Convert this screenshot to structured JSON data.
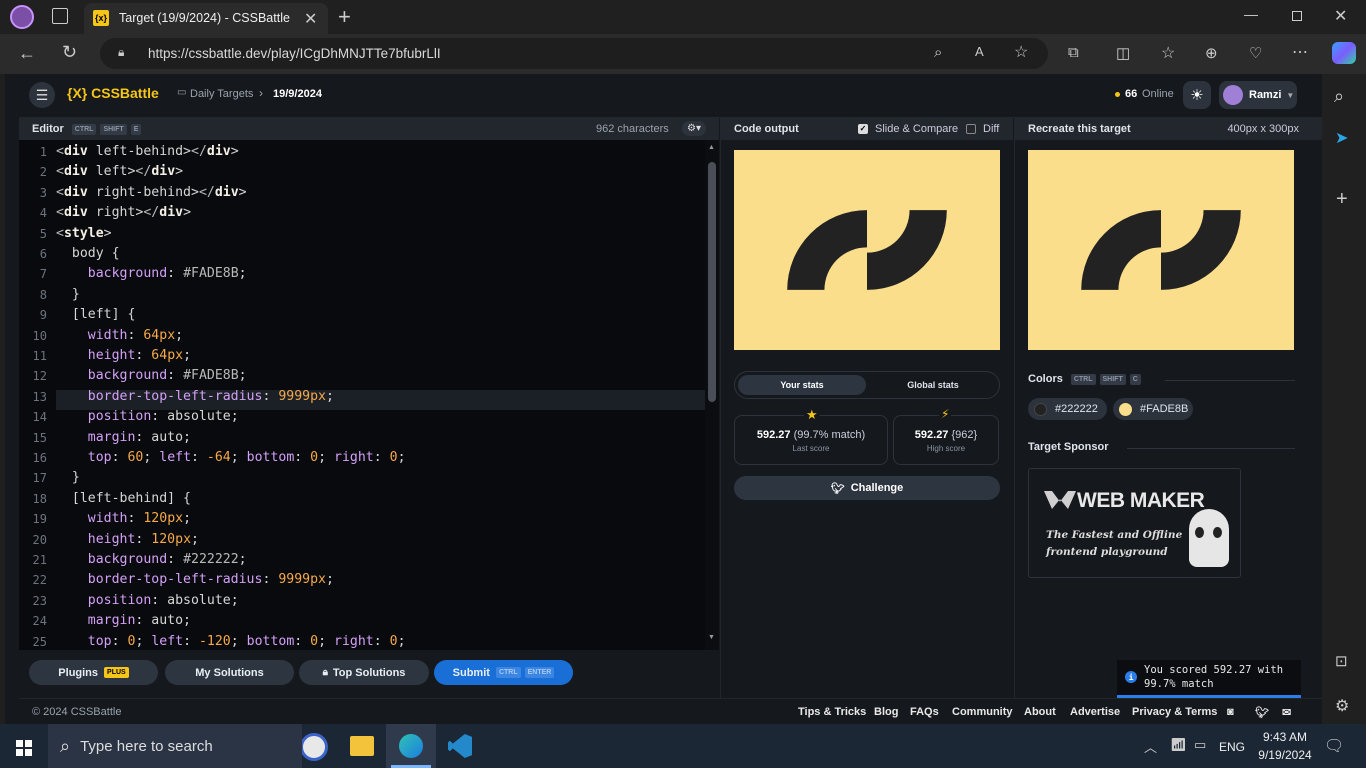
{
  "browser": {
    "tab_title": "Target (19/9/2024) - CSSBattle",
    "url": "https://cssbattle.dev/play/ICgDhMNJTTe7bfubrLlI"
  },
  "header": {
    "logo": "{X} CSSBattle",
    "breadcrumb_parent": "Daily Targets",
    "breadcrumb_current": "19/9/2024",
    "online_count": "66",
    "online_label": "Online",
    "user_name": "Ramzi"
  },
  "editor": {
    "title": "Editor",
    "shortcut": [
      "CTRL",
      "SHIFT",
      "E"
    ],
    "char_count": "962 characters",
    "lines": [
      "<div left-behind></div>",
      "<div left></div>",
      "<div right-behind></div>",
      "<div right></div>",
      "<style>",
      "  body {",
      "    background: #FADE8B;",
      "  }",
      "  [left] {",
      "    width: 64px;",
      "    height: 64px;",
      "    background: #FADE8B;",
      "    border-top-left-radius: 9999px;",
      "    position: absolute;",
      "    margin: auto;",
      "    top: 60; left: -64; bottom: 0; right: 0;",
      "  }",
      "  [left-behind] {",
      "    width: 120px;",
      "    height: 120px;",
      "    background: #222222;",
      "    border-top-left-radius: 9999px;",
      "    position: absolute;",
      "    margin: auto;",
      "    top: 0; left: -120; bottom: 0; right: 0;"
    ]
  },
  "bottom_buttons": {
    "plugins": "Plugins",
    "plus": "PLUS",
    "my_solutions": "My Solutions",
    "top_solutions": "Top Solutions",
    "submit": "Submit",
    "submit_ctrl": "CTRL",
    "submit_enter": "ENTER"
  },
  "output": {
    "title": "Code output",
    "slide_compare": "Slide & Compare",
    "diff": "Diff",
    "tab_your": "Your stats",
    "tab_global": "Global stats",
    "last_score": "592.27",
    "last_match": "(99.7% match)",
    "last_label": "Last score",
    "high_score": "592.27",
    "high_chars": "{962}",
    "high_label": "High score",
    "challenge": "Challenge"
  },
  "target": {
    "title": "Recreate this target",
    "size": "400px x 300px",
    "colors_label": "Colors",
    "colors_shortcut": [
      "CTRL",
      "SHIFT",
      "C"
    ],
    "color1": "#222222",
    "color2": "#FADE8B",
    "sponsor_label": "Target Sponsor",
    "sponsor_name": "WEB MAKER",
    "sponsor_tag1": "The Fastest and Offline",
    "sponsor_tag2": "frontend playground"
  },
  "toast": {
    "line1": "You scored 592.27 with",
    "line2": "99.7% match"
  },
  "footer": {
    "copyright": "© 2024 CSSBattle",
    "links": [
      "Tips & Tricks",
      "Blog",
      "FAQs",
      "Community",
      "About",
      "Advertise",
      "Privacy & Terms"
    ]
  },
  "taskbar": {
    "search_placeholder": "Type here to search",
    "lang": "ENG",
    "time": "9:43 AM",
    "date": "9/19/2024"
  },
  "colors": {
    "dark": "#222222",
    "yellow": "#FADE8B",
    "accent": "#2b7de9"
  }
}
